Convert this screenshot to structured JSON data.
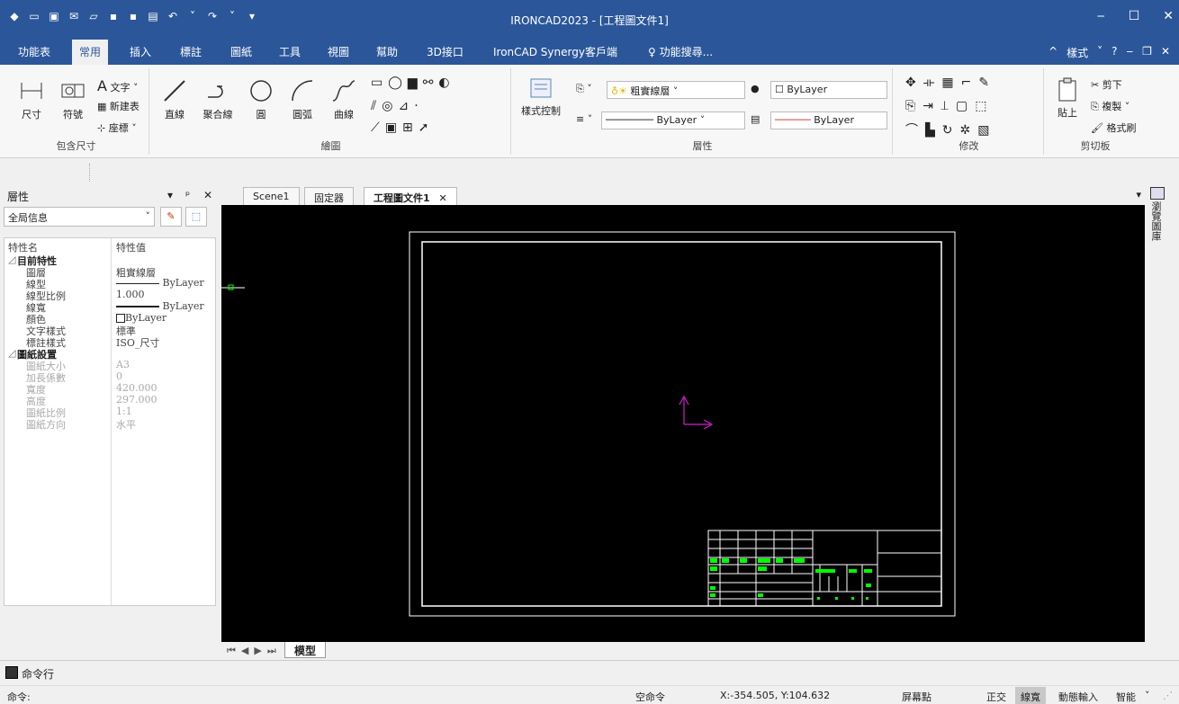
{
  "window": {
    "title": "IRONCAD2023 - [工程圖文件1]",
    "min": "‒",
    "max": "☐",
    "close": "✕"
  },
  "menu": {
    "tabs": [
      "功能表",
      "常用",
      "插入",
      "標註",
      "圖紙",
      "工具",
      "視圖",
      "幫助",
      "3D接口",
      "IronCAD Synergy客戶端"
    ],
    "search": "功能搜尋...",
    "style": "樣式"
  },
  "ribbon": {
    "groups": {
      "dim": "包含尺寸",
      "draw": "繪圖",
      "layer": "層性",
      "modify": "修改",
      "clipboard": "剪切板"
    },
    "dim": {
      "dimension": "尺寸",
      "symbol": "符號",
      "text": "文字",
      "new_table": "新建表",
      "coords": "座標"
    },
    "draw": {
      "line": "直線",
      "polyline": "聚合線",
      "circle": "圓",
      "arc": "圓弧",
      "curve": "曲線"
    },
    "layer": {
      "style_control": "樣式控制",
      "layer_name": "粗實線層",
      "bylayer1": "ByLayer",
      "bylayer2": "ByLayer",
      "bylayer3": "ByLayer"
    },
    "clipboard": {
      "paste": "貼上",
      "cut": "剪下",
      "copy": "複製",
      "format": "格式刷"
    }
  },
  "panel": {
    "title": "層性",
    "combo": "全局信息",
    "col_name": "特性名",
    "col_value": "特性值",
    "rows": [
      {
        "k": "目前特性",
        "v": "",
        "sec": true
      },
      {
        "k": "圖層",
        "v": "粗實線層"
      },
      {
        "k": "線型",
        "v": "ByLayer"
      },
      {
        "k": "線型比例",
        "v": "1.000"
      },
      {
        "k": "線寬",
        "v": "ByLayer"
      },
      {
        "k": "顏色",
        "v": "ByLayer"
      },
      {
        "k": "文字樣式",
        "v": "標準"
      },
      {
        "k": "標註樣式",
        "v": "ISO_尺寸"
      },
      {
        "k": "圖紙設置",
        "v": "",
        "sec": true
      },
      {
        "k": "圖紙大小",
        "v": "A3",
        "dis": true
      },
      {
        "k": "加長係數",
        "v": "0",
        "dis": true
      },
      {
        "k": "寬度",
        "v": "420.000",
        "dis": true
      },
      {
        "k": "高度",
        "v": "297.000",
        "dis": true
      },
      {
        "k": "圖紙比例",
        "v": "1:1",
        "dis": true
      },
      {
        "k": "圖紙方向",
        "v": "水平",
        "dis": true
      }
    ]
  },
  "doc_tabs": [
    "Scene1",
    "固定器",
    "工程圖文件1"
  ],
  "sheet_tab": "模型",
  "right_strip": "瀏覽圖庫",
  "cmdline": {
    "label": "命令行",
    "prompt": "命令:"
  },
  "status": {
    "no_command": "空命令",
    "coords": "X:-354.505, Y:104.632",
    "snap": "屏幕點",
    "ortho": "正交",
    "lineweight": "線寬",
    "dyn_input": "動態輸入",
    "smart": "智能"
  },
  "colors": {
    "accent": "#2b579a",
    "canvas": "#000000",
    "ucs": "#d020d0",
    "titleblock_text": "#00ff00"
  }
}
